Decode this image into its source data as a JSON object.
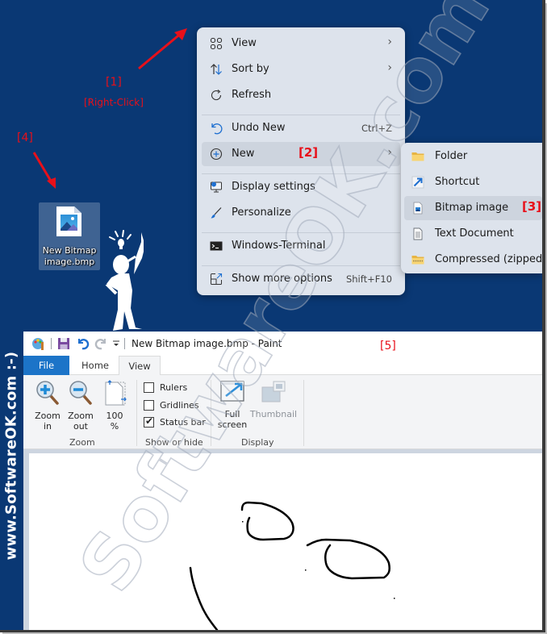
{
  "annotations": {
    "step1": "[1]",
    "step1_caption": "[Right-Click]",
    "step2": "[2]",
    "step3": "[3]",
    "step4": "[4]",
    "step5": "[5]",
    "color": "#e8101a"
  },
  "side_brand": "www.SoftwareOK.com :-)",
  "watermark": "SoftwareOK.com",
  "desktop": {
    "background_color": "#0a3874",
    "icon": {
      "label_line1": "New Bitmap",
      "label_line2": "image.bmp",
      "icon": "bitmap-file-icon"
    }
  },
  "context_menu": {
    "items": [
      {
        "label": "View",
        "icon": "view-grid-icon",
        "submenu": true
      },
      {
        "label": "Sort by",
        "icon": "sort-arrows-icon",
        "submenu": true
      },
      {
        "label": "Refresh",
        "icon": "refresh-icon"
      },
      {
        "label": "Undo New",
        "icon": "undo-icon",
        "shortcut": "Ctrl+Z"
      },
      {
        "label": "New",
        "icon": "plus-circle-icon",
        "submenu": true,
        "highlighted": true
      },
      {
        "label": "Display settings",
        "icon": "display-settings-icon"
      },
      {
        "label": "Personalize",
        "icon": "brush-icon"
      },
      {
        "label": "Windows-Terminal",
        "icon": "terminal-icon"
      },
      {
        "label": "Show more options",
        "icon": "more-options-icon",
        "shortcut": "Shift+F10"
      }
    ],
    "chevron": "›"
  },
  "new_submenu": {
    "items": [
      {
        "label": "Folder",
        "icon": "folder-icon"
      },
      {
        "label": "Shortcut",
        "icon": "shortcut-icon"
      },
      {
        "label": "Bitmap image",
        "icon": "bitmap-icon",
        "highlighted": true
      },
      {
        "label": "Text Document",
        "icon": "text-document-icon"
      },
      {
        "label": "Compressed (zipped)",
        "icon": "zip-folder-icon"
      }
    ]
  },
  "paint": {
    "title": "New Bitmap image.bmp - Paint",
    "quick_access": [
      "paint-app-icon",
      "save-icon",
      "undo-icon",
      "redo-icon",
      "customize-dropdown-icon"
    ],
    "tabs": [
      {
        "label": "File",
        "active": false
      },
      {
        "label": "Home",
        "active": false
      },
      {
        "label": "View",
        "active": true
      }
    ],
    "ribbon": {
      "zoom_group": {
        "label": "Zoom",
        "zoom_in_line1": "Zoom",
        "zoom_in_line2": "in",
        "zoom_out_line1": "Zoom",
        "zoom_out_line2": "out",
        "actual_line1": "100",
        "actual_line2": "%"
      },
      "show_hide_group": {
        "label": "Show or hide",
        "checkboxes": [
          {
            "label": "Rulers",
            "checked": false
          },
          {
            "label": "Gridlines",
            "checked": false
          },
          {
            "label": "Status bar",
            "checked": true
          }
        ]
      },
      "display_group": {
        "label": "Display",
        "full_screen_line1": "Full",
        "full_screen_line2": "screen",
        "thumbnail": "Thumbnail"
      }
    }
  }
}
